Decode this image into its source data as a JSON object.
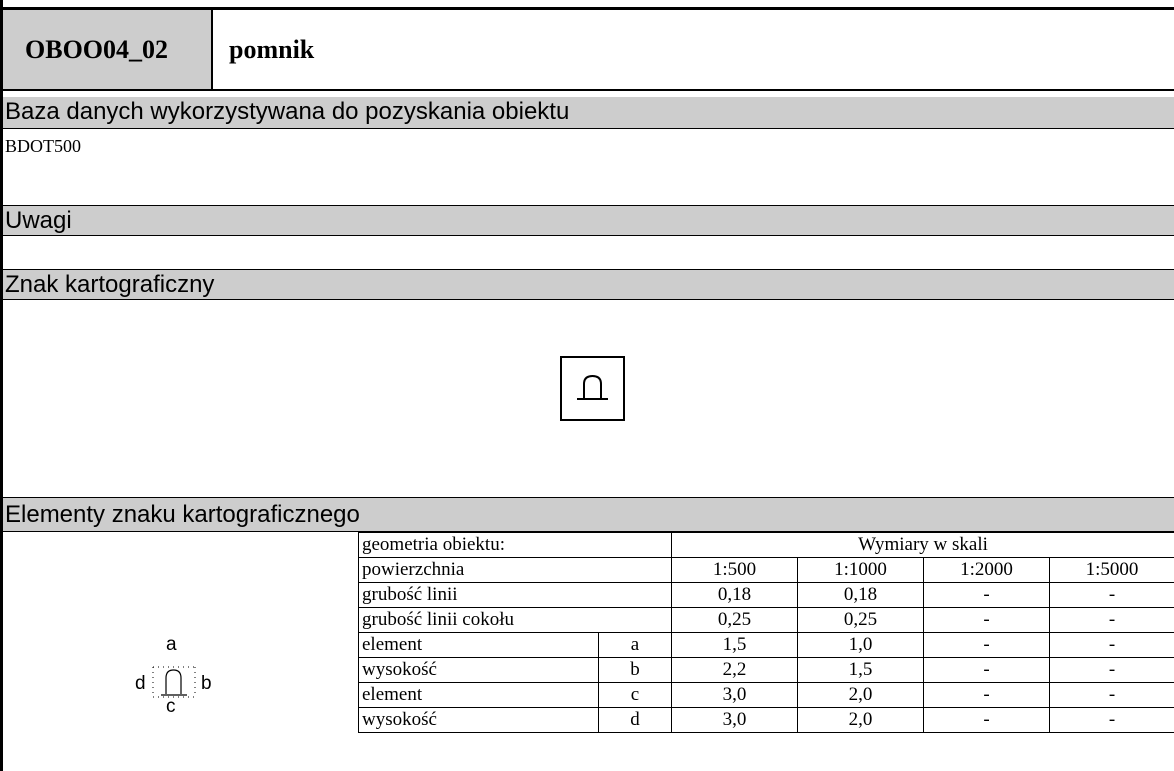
{
  "header": {
    "code": "OBOO04_02",
    "name": "pomnik"
  },
  "sections": {
    "database_title": "Baza danych wykorzystywana do pozyskania obiektu",
    "database_value": "BDOT500",
    "notes_title": "Uwagi",
    "notes_value": "",
    "sign_title": "Znak kartograficzny",
    "elements_title": "Elementy znaku kartograficznego"
  },
  "sign": {
    "icon": "monument-arch-icon"
  },
  "diagram_labels": {
    "a": "a",
    "b": "b",
    "c": "c",
    "d": "d"
  },
  "table": {
    "geometry_label": "geometria obiektu:",
    "geometry_value": "powierzchnia",
    "scales_header": "Wymiary w skali",
    "scales": [
      "1:500",
      "1:1000",
      "1:2000",
      "1:5000"
    ],
    "rows": [
      {
        "name": "grubość linii",
        "code": "",
        "values": [
          "0,18",
          "0,18",
          "-",
          "-"
        ]
      },
      {
        "name": "grubość linii cokołu",
        "code": "",
        "values": [
          "0,25",
          "0,25",
          "-",
          "-"
        ]
      },
      {
        "name": "element",
        "code": "a",
        "values": [
          "1,5",
          "1,0",
          "-",
          "-"
        ]
      },
      {
        "name": "wysokość",
        "code": "b",
        "values": [
          "2,2",
          "1,5",
          "-",
          "-"
        ]
      },
      {
        "name": "element",
        "code": "c",
        "values": [
          "3,0",
          "2,0",
          "-",
          "-"
        ]
      },
      {
        "name": "wysokość",
        "code": "d",
        "values": [
          "3,0",
          "2,0",
          "-",
          "-"
        ]
      }
    ]
  }
}
